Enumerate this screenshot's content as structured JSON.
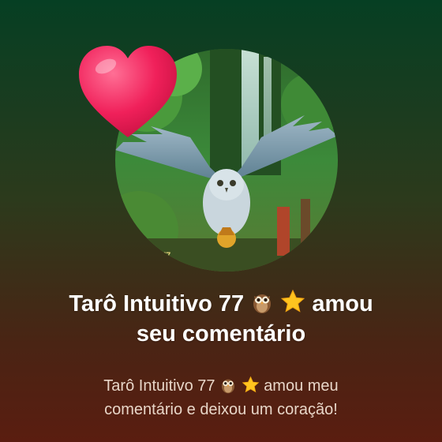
{
  "notification": {
    "heart_icon": "heart-icon",
    "avatar_image": "profile-avatar-snowy-owl",
    "title_name": "Tarô Intuitivo 77",
    "title_action_line1": "amou",
    "title_line2": "seu comentário",
    "subtitle_name": "Tarô Intuitivo 77",
    "subtitle_rest_line1": "amou meu",
    "subtitle_line2": "comentário e deixou um coração!",
    "emojis": [
      "owl-emoji",
      "star-emoji"
    ]
  },
  "colors": {
    "background_top": "#063f23",
    "background_bottom": "#5a1d10",
    "heart": "#f0205a",
    "title_text": "#ffffff",
    "subtitle_text": "#e8d6c8"
  }
}
